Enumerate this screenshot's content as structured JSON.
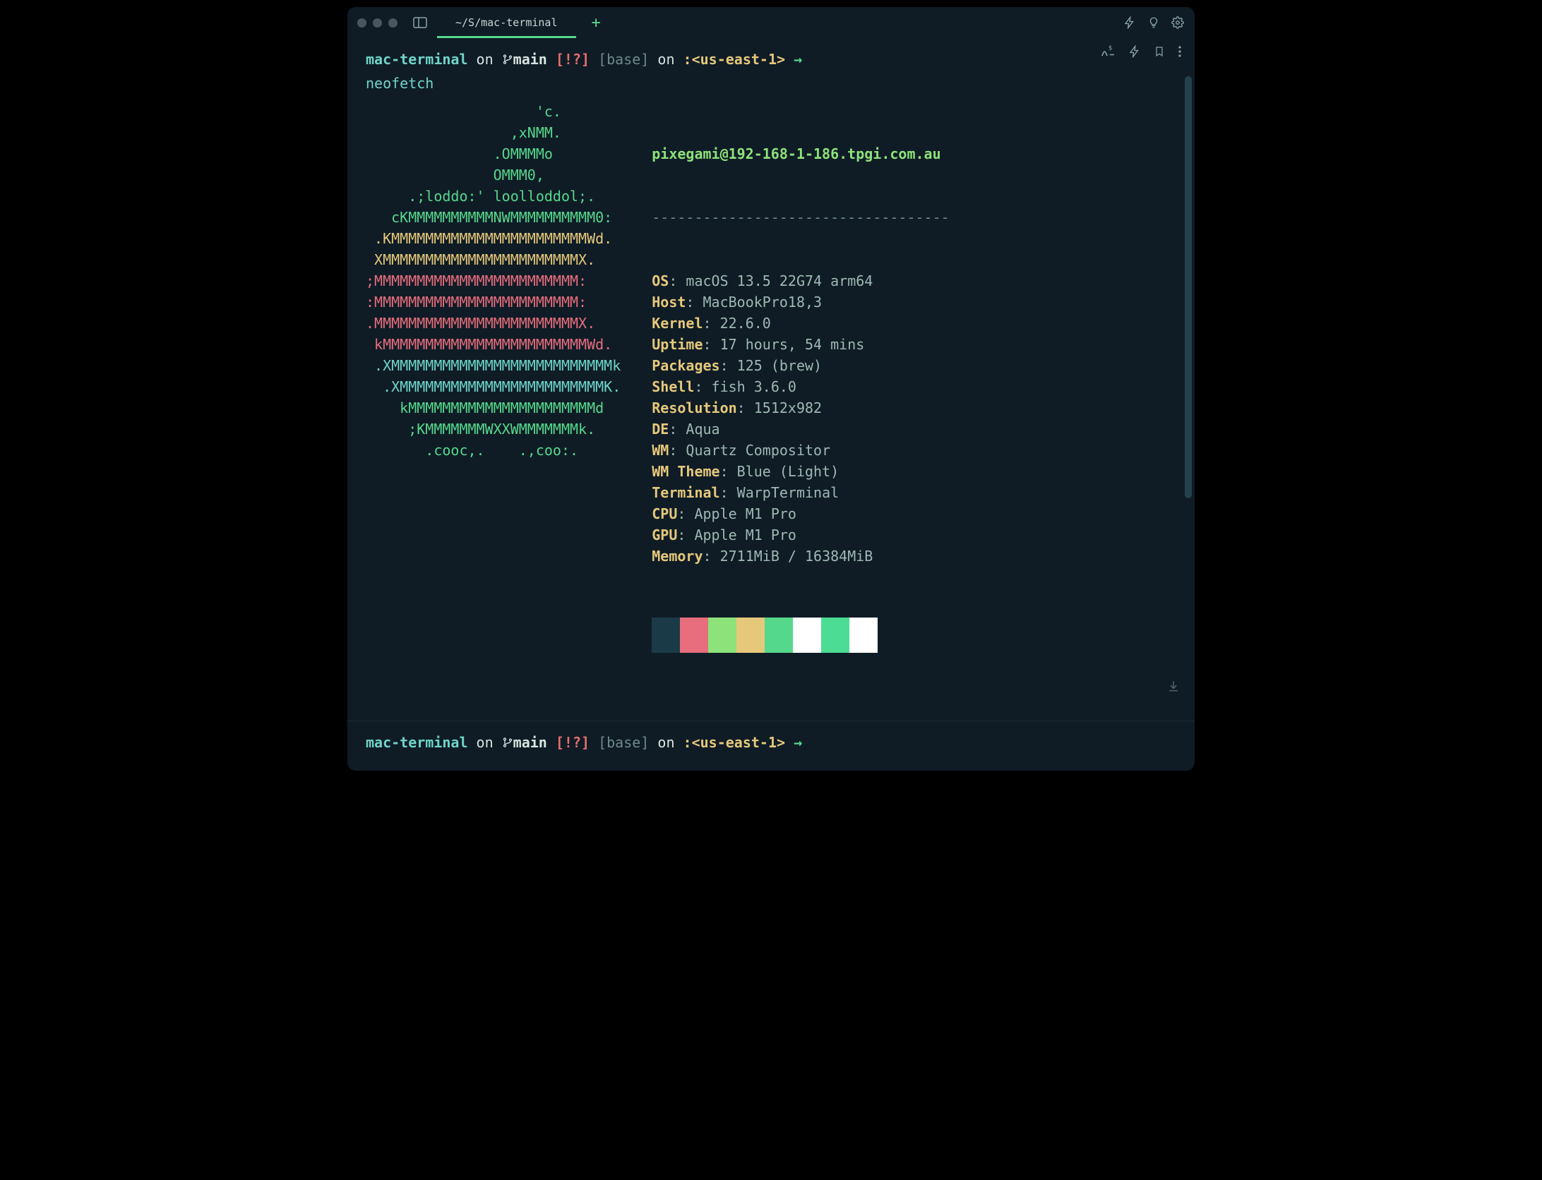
{
  "titlebar": {
    "tab_title": "~/S/mac-terminal"
  },
  "prompt": {
    "dir": "mac-terminal",
    "on1": " on ",
    "branch_icon": " ",
    "branch": "main",
    "flags": " [!?]",
    "env": " [base]",
    "on2": " on ",
    "region_marker": ":",
    "region": "<us-east-1>",
    "arrow": " → "
  },
  "command": "neofetch",
  "ascii": [
    {
      "t": "                    'c.",
      "c": "c-brightgreen"
    },
    {
      "t": "                 ,xNMM.",
      "c": "c-brightgreen"
    },
    {
      "t": "               .OMMMMo",
      "c": "c-brightgreen"
    },
    {
      "t": "               OMMM0,",
      "c": "c-brightgreen"
    },
    {
      "t": "     .;loddo:' loolloddol;.",
      "c": "c-brightgreen"
    },
    {
      "t": "   cKMMMMMMMMMMNWMMMMMMMMMM0:",
      "c": "c-brightgreen"
    },
    {
      "t": " .KMMMMMMMMMMMMMMMMMMMMMMMWd.",
      "c": "c-yellow"
    },
    {
      "t": " XMMMMMMMMMMMMMMMMMMMMMMMX.",
      "c": "c-yellow"
    },
    {
      "t": ";MMMMMMMMMMMMMMMMMMMMMMMM:",
      "c": "c-pink"
    },
    {
      "t": ":MMMMMMMMMMMMMMMMMMMMMMMM:",
      "c": "c-pink"
    },
    {
      "t": ".MMMMMMMMMMMMMMMMMMMMMMMMX.",
      "c": "c-pink"
    },
    {
      "t": " kMMMMMMMMMMMMMMMMMMMMMMMMWd.",
      "c": "c-pink"
    },
    {
      "t": " .XMMMMMMMMMMMMMMMMMMMMMMMMMMk",
      "c": "c-cyan"
    },
    {
      "t": "  .XMMMMMMMMMMMMMMMMMMMMMMMMK.",
      "c": "c-cyan"
    },
    {
      "t": "    kMMMMMMMMMMMMMMMMMMMMMMd",
      "c": "c-brightgreen"
    },
    {
      "t": "     ;KMMMMMMMWXXWMMMMMMMk.",
      "c": "c-brightgreen"
    },
    {
      "t": "       .cooc,.    .,coo:.",
      "c": "c-brightgreen"
    }
  ],
  "info": {
    "user": "pixegami@192-168-1-186.tpgi.com.au",
    "sep": "-----------------------------------",
    "rows": [
      {
        "k": "OS",
        "v": "macOS 13.5 22G74 arm64"
      },
      {
        "k": "Host",
        "v": "MacBookPro18,3"
      },
      {
        "k": "Kernel",
        "v": "22.6.0"
      },
      {
        "k": "Uptime",
        "v": "17 hours, 54 mins"
      },
      {
        "k": "Packages",
        "v": "125 (brew)"
      },
      {
        "k": "Shell",
        "v": "fish 3.6.0"
      },
      {
        "k": "Resolution",
        "v": "1512x982"
      },
      {
        "k": "DE",
        "v": "Aqua"
      },
      {
        "k": "WM",
        "v": "Quartz Compositor"
      },
      {
        "k": "WM Theme",
        "v": "Blue (Light)"
      },
      {
        "k": "Terminal",
        "v": "WarpTerminal"
      },
      {
        "k": "CPU",
        "v": "Apple M1 Pro"
      },
      {
        "k": "GPU",
        "v": "Apple M1 Pro"
      },
      {
        "k": "Memory",
        "v": "2711MiB / 16384MiB"
      }
    ]
  },
  "swatches": [
    "#1a3a47",
    "#e86d7d",
    "#8de27a",
    "#e6c87a",
    "#56d88c",
    "#ffffff",
    "#4ddc93",
    "#ffffff"
  ]
}
